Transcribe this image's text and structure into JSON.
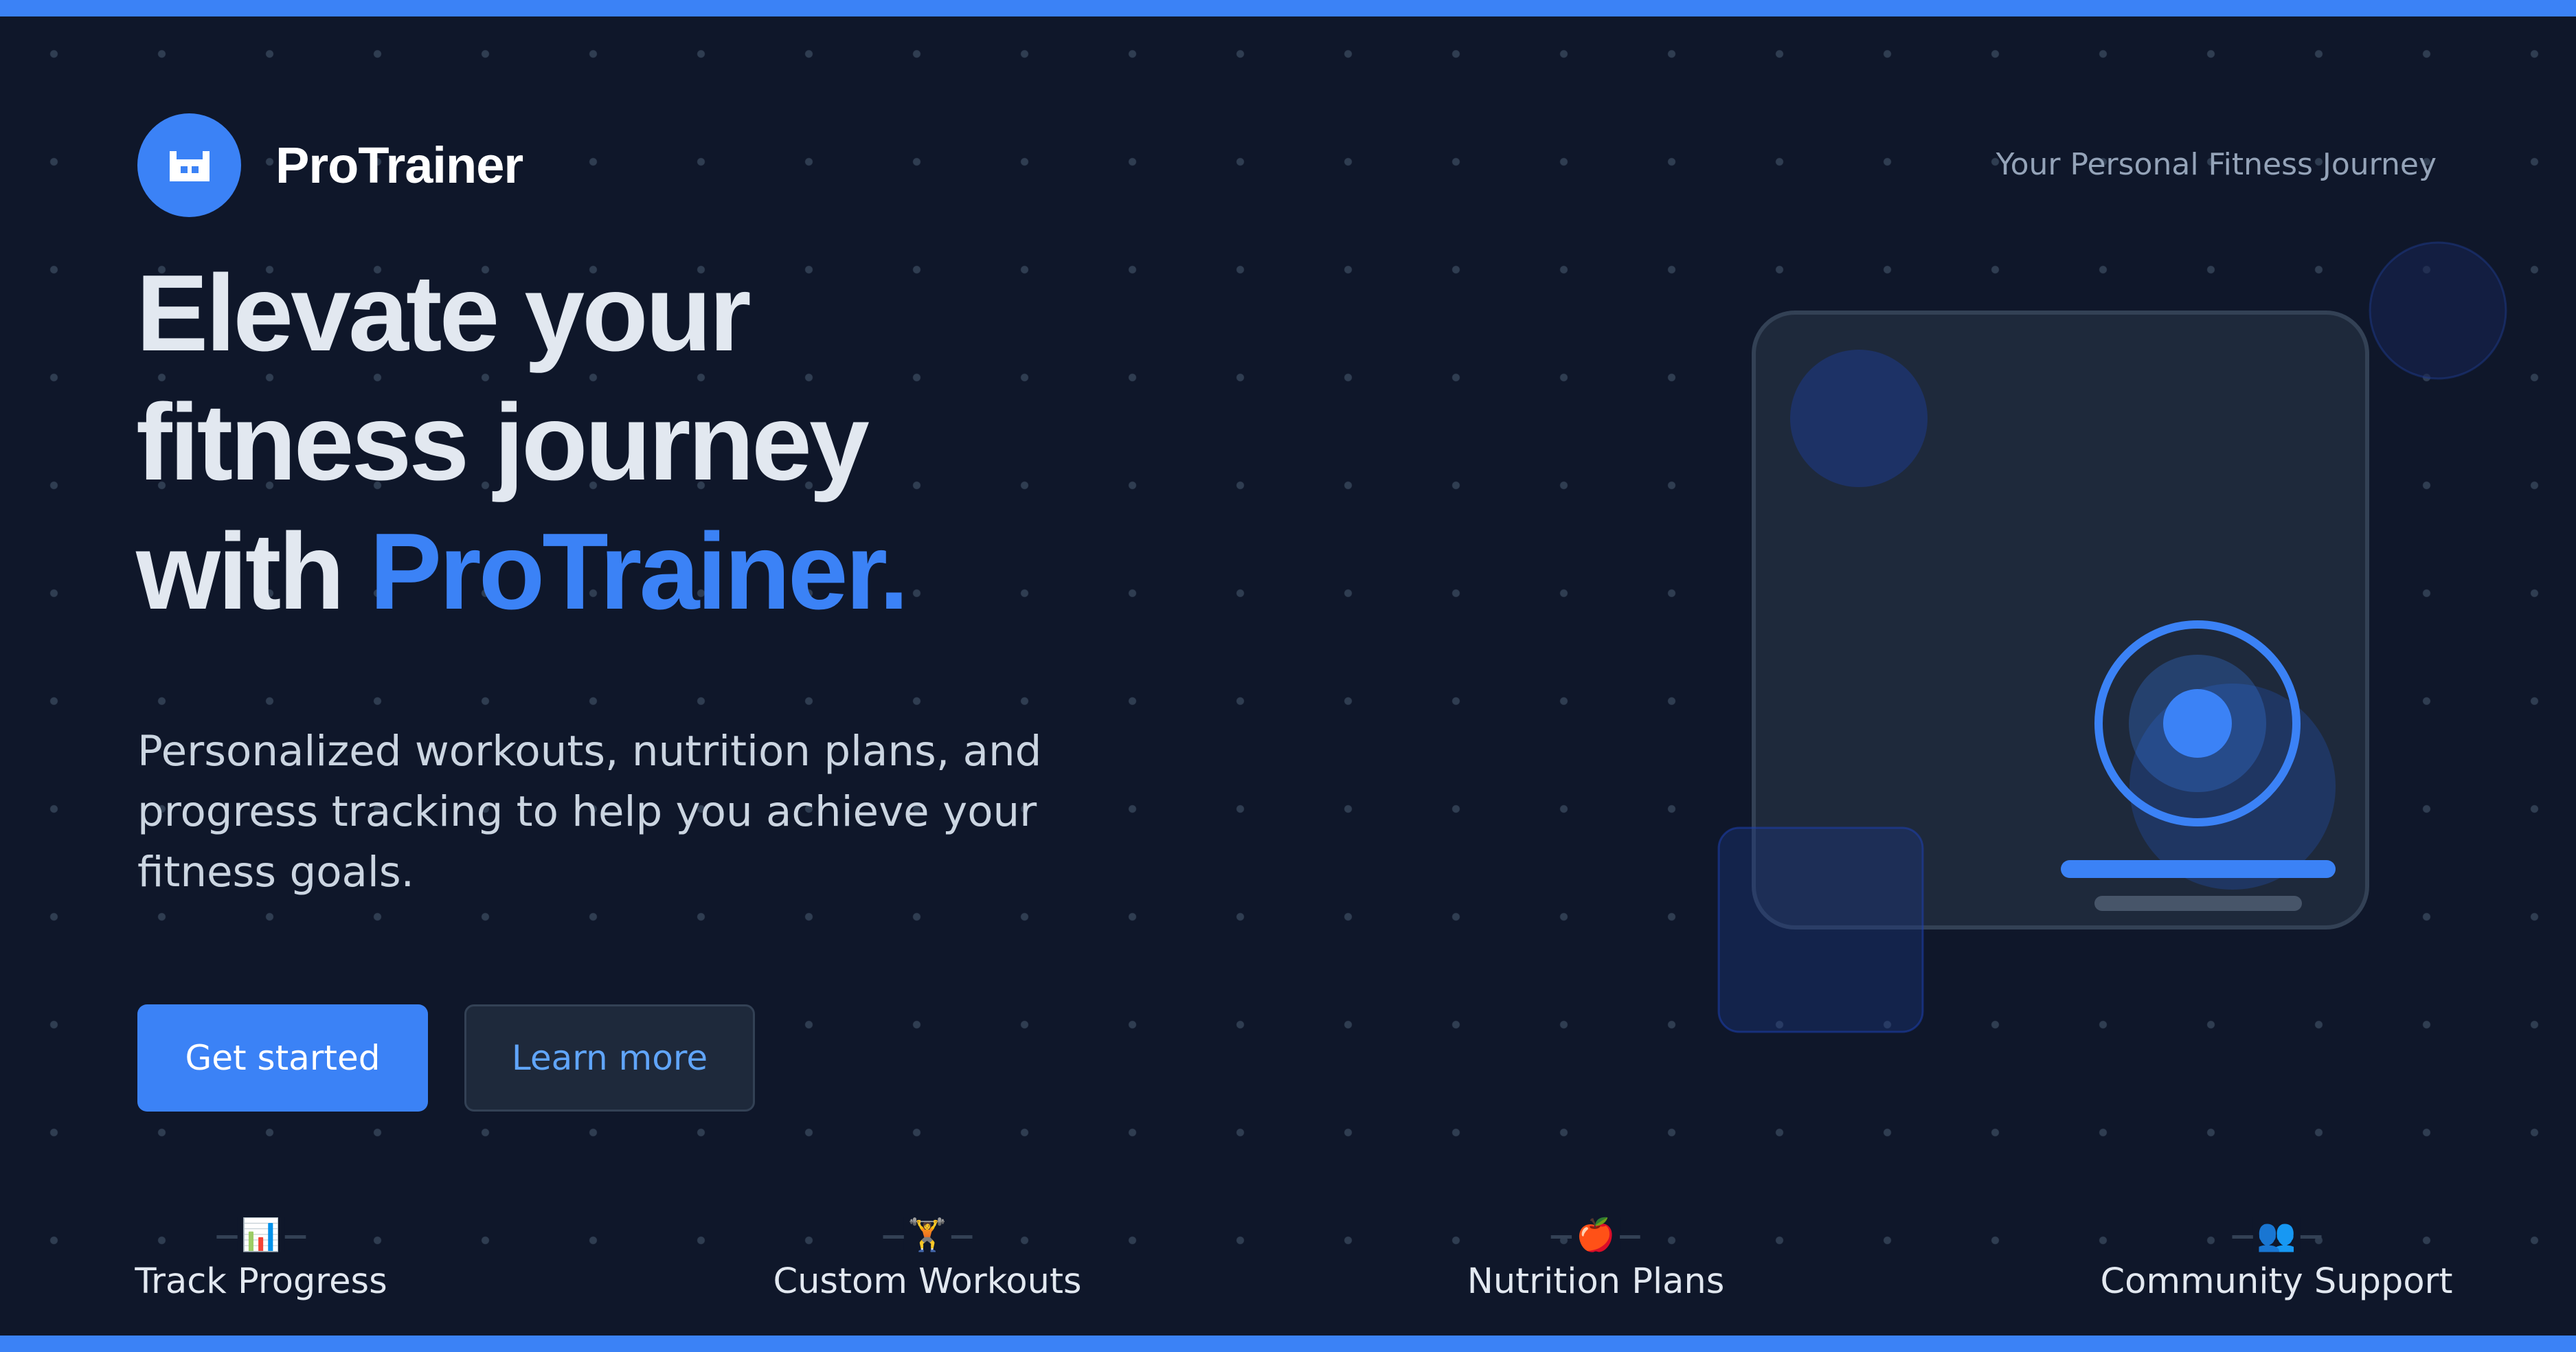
{
  "header": {
    "brand_name": "ProTrainer",
    "tagline": "Your Personal Fitness Journey"
  },
  "hero": {
    "headline_line1": "Elevate your",
    "headline_line2": "fitness journey",
    "headline_line3_prefix": "with",
    "headline_accent": "ProTrainer.",
    "subtitle": "Personalized workouts, nutrition plans, and progress tracking to help you achieve your fitness goals.",
    "primary_button": "Get started",
    "secondary_button": "Learn more"
  },
  "features": [
    {
      "label": "Track Progress",
      "icon": "bar-chart-icon",
      "glyph": "📊"
    },
    {
      "label": "Custom Workouts",
      "icon": "weightlifter-icon",
      "glyph": "🏋️"
    },
    {
      "label": "Nutrition Plans",
      "icon": "apple-icon",
      "glyph": "🍎"
    },
    {
      "label": "Community Support",
      "icon": "people-icon",
      "glyph": "👥"
    }
  ],
  "colors": {
    "background": "#0f172a",
    "accent": "#3b82f6",
    "card": "#1e293b",
    "text": "#e2e8f0",
    "muted": "#94a3b8"
  }
}
